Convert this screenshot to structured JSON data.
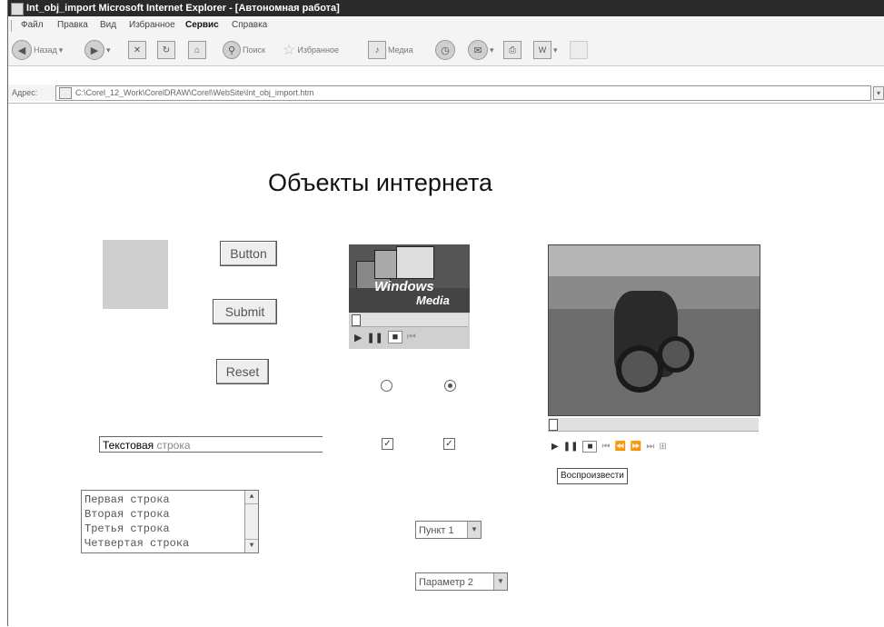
{
  "window": {
    "title": "Int_obj_import  Microsoft Internet Explorer - [Автономная работа]"
  },
  "menu": [
    "Файл",
    "Правка",
    "Вид",
    "Избранное",
    "Сервис",
    "Справка"
  ],
  "toolbar": {
    "back_label": "Назад",
    "search_label": "Поиск",
    "favorites_label": "Избранное",
    "media_label": "Медиа"
  },
  "address": {
    "label": "Адрес:",
    "url": "C:\\Corel_12_Work\\CorelDRAW\\Corel\\WebSite\\Int_obj_import.htm"
  },
  "page": {
    "heading": "Объекты интернета",
    "buttons": {
      "button": "Button",
      "submit": "Submit",
      "reset": "Reset"
    },
    "media_logo": {
      "line1": "Windows",
      "line2": "Media"
    },
    "radios": [
      {
        "checked": false
      },
      {
        "checked": true
      }
    ],
    "checkboxes": [
      {
        "checked": true
      },
      {
        "checked": true
      }
    ],
    "text_input": {
      "value_dark": "Текстовая",
      "value_light": " строка"
    },
    "listbox": [
      "Первая строка",
      "Вторая строка",
      "Третья строка",
      "Четвертая строка"
    ],
    "select1": "Пункт 1",
    "select2": "Параметр 2",
    "tooltip": "Воспроизвести"
  }
}
